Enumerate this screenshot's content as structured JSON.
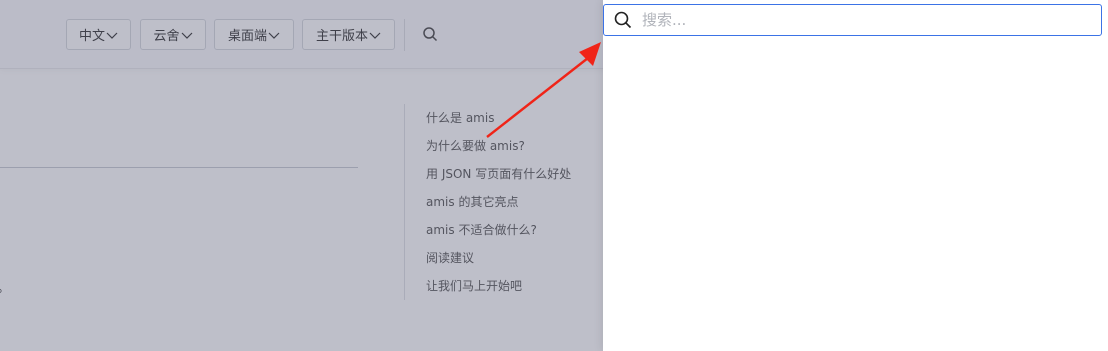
{
  "topbar": {
    "language": "中文",
    "theme": "云舍",
    "platform": "桌面端",
    "version": "主干版本"
  },
  "content": {
    "truncated_text": "。"
  },
  "toc": {
    "items": [
      "什么是 amis",
      "为什么要做 amis?",
      "用 JSON 写页面有什么好处",
      "amis 的其它亮点",
      "amis 不适合做什么?",
      "阅读建议",
      "让我们马上开始吧"
    ]
  },
  "search": {
    "placeholder": "搜索...",
    "value": ""
  },
  "colors": {
    "mask": "#535871",
    "focus_border": "#3b73e6",
    "annotation_arrow": "#f02418"
  },
  "icons": {
    "caret": "chevron-down-icon",
    "search": "search-icon",
    "annotation": "arrow-icon"
  }
}
